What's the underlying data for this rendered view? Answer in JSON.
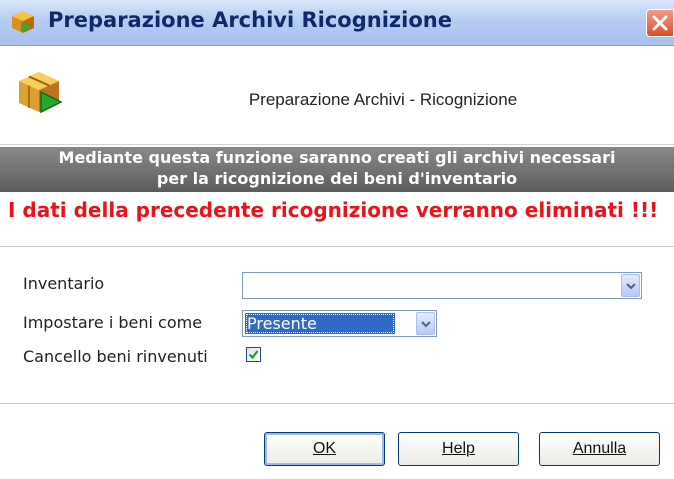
{
  "window": {
    "title": "Preparazione Archivi Ricognizione",
    "close_icon": "close-icon"
  },
  "header": {
    "title": "Preparazione Archivi - Ricognizione",
    "icon": "package-play-icon"
  },
  "banner": {
    "line1": "Mediante questa funzione saranno creati gli archivi necessari",
    "line2": "per la ricognizione dei beni d'inventario"
  },
  "warning": "I dati della precedente ricognizione verranno eliminati !!!",
  "form": {
    "inventario": {
      "label": "Inventario",
      "value": ""
    },
    "impostare": {
      "label": "Impostare i beni come",
      "value": "Presente"
    },
    "cancello": {
      "label": "Cancello beni rinvenuti",
      "checked": true
    }
  },
  "buttons": {
    "ok": "OK",
    "help": "Help",
    "annulla": "Annulla"
  },
  "colors": {
    "title_text": "#0d2b6b",
    "warning": "#e8131b",
    "selection": "#316ac5"
  }
}
